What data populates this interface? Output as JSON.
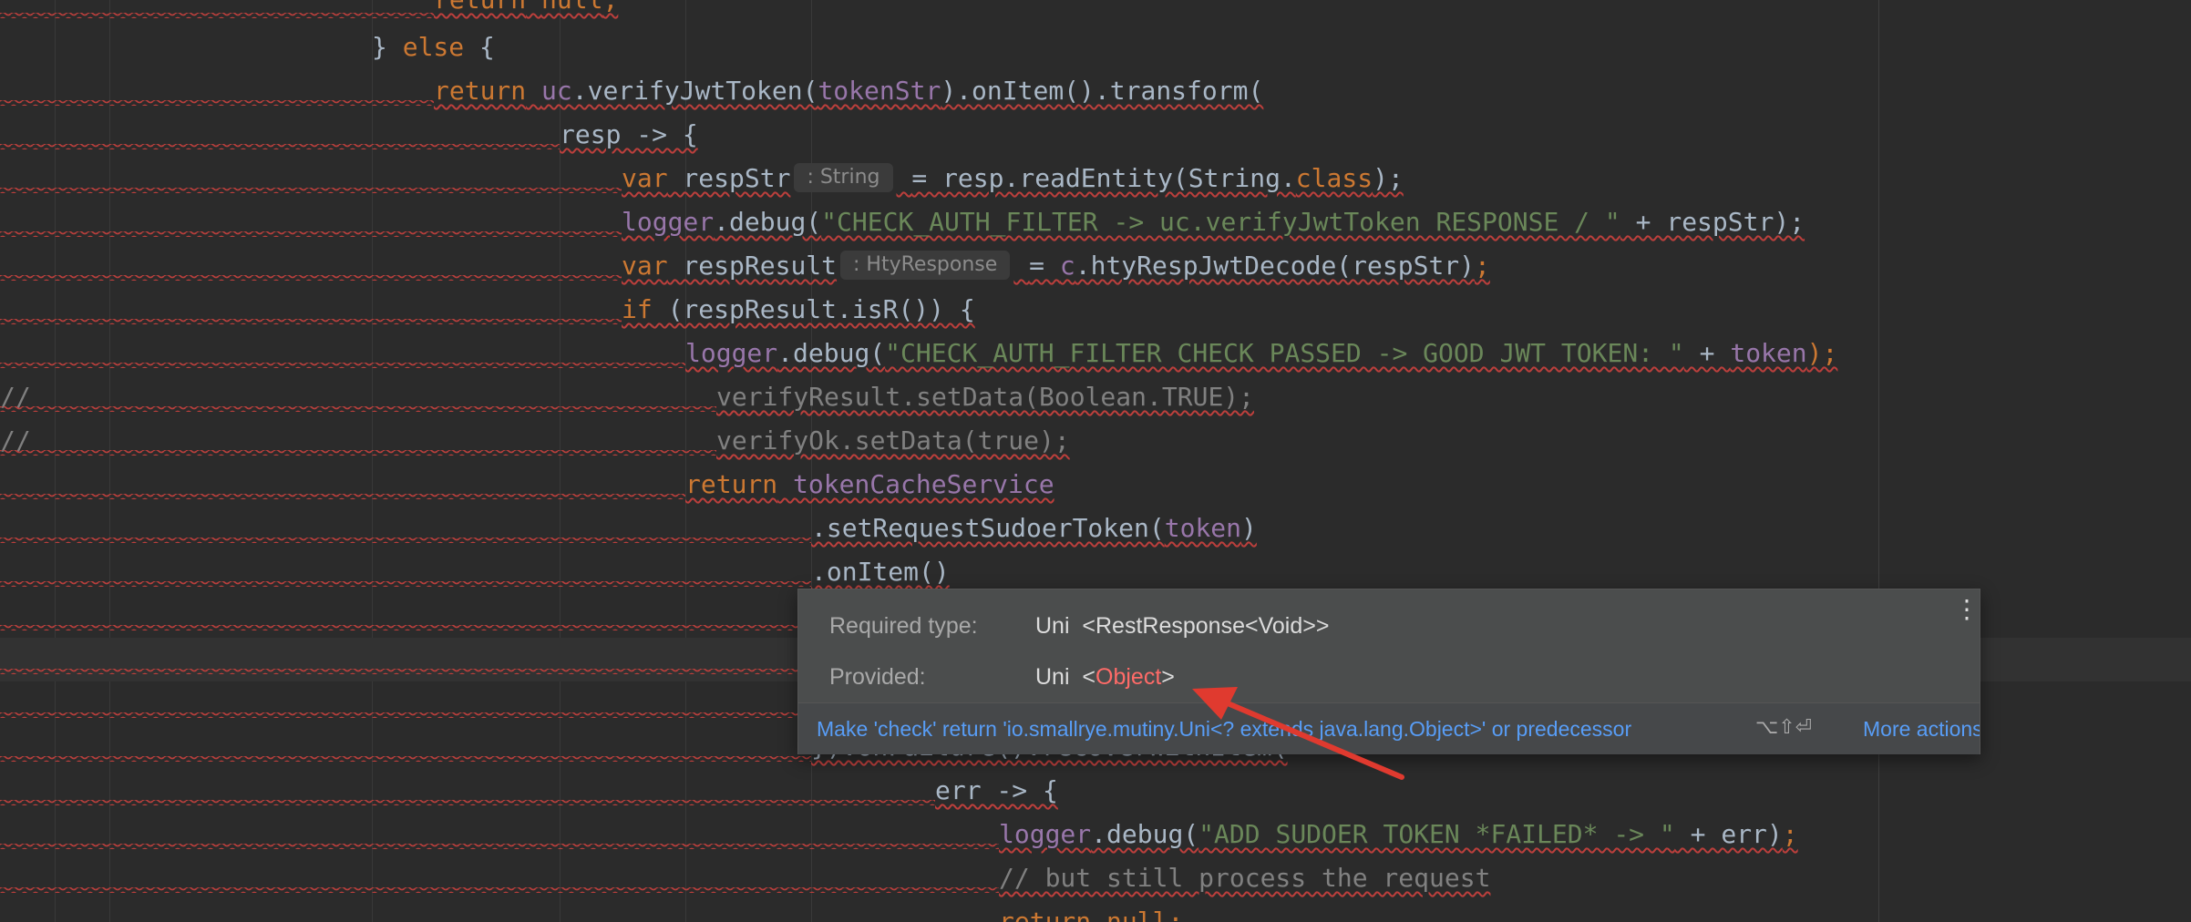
{
  "code_lines": [
    {
      "num": "1",
      "top": 0,
      "indent": 476,
      "parts": [
        {
          "t": "return null;",
          "c": "kw"
        }
      ]
    },
    {
      "num": "2",
      "top": 0,
      "indent": 0,
      "parts": []
    },
    {
      "num": "3",
      "top": 0,
      "indent": 0,
      "parts": []
    }
  ],
  "lines": {
    "l0": {
      "return_kw": "return",
      "null_kw": "null",
      "semi": ";"
    },
    "l1": {
      "brace": "} ",
      "else_kw": "else",
      "brace2": " {"
    },
    "l2": {
      "return_kw": "return",
      "uc": "uc",
      "call": ".verifyJwtToken(",
      "arg": "tokenStr",
      "rest": ").onItem().transform("
    },
    "l3": {
      "text": "resp -> {"
    },
    "l4": {
      "var_kw": "var",
      "name": " respStr",
      "hint": ": String",
      "rest": "= resp.readEntity(String.",
      "class_kw": "class",
      "end": ");"
    },
    "l5": {
      "logger": "logger",
      "call": ".debug(",
      "str": "\"CHECK_AUTH_FILTER -> uc.verifyJwtToken RESPONSE / \"",
      "rest": " + respStr);"
    },
    "l6": {
      "var_kw": "var",
      "name": " respResult",
      "hint": ": HtyResponse",
      "eq": "= ",
      "c": "c",
      "rest": ".htyRespJwtDecode(respStr)",
      "semi": ";"
    },
    "l7": {
      "if_kw": "if",
      "rest": " (respResult.isR()) {"
    },
    "l8": {
      "logger": "logger",
      "call": ".debug(",
      "str": "\"CHECK_AUTH_FILTER CHECK PASSED -> GOOD JWT TOKEN: \"",
      "plus": " + ",
      "token": "token",
      "end": ");"
    },
    "l9": {
      "slashes": "//",
      "text": "verifyResult.setData(Boolean.TRUE);"
    },
    "l10": {
      "slashes": "//",
      "text": "verifyOk.setData(true);"
    },
    "l11": {
      "return_kw": "return",
      "svc": " tokenCacheService"
    },
    "l12": {
      "call": ".setRequestSudoerToken(",
      "token": "token",
      "end": ")"
    },
    "l13": {
      "text": ".onItem()"
    },
    "l14": {
      "text": "}).onFailure().recoverWithItem("
    },
    "l15": {
      "text": "err -> {"
    },
    "l16": {
      "logger": "logger",
      "call": ".debug(",
      "str": "\"ADD SUDOER TOKEN *FAILED* -> \"",
      "rest": " + err)",
      "semi": ";"
    },
    "l17": {
      "text": "// but still process the request"
    },
    "l18": {
      "return_kw": "return",
      "null_kw": " null",
      "semi": ";"
    }
  },
  "popup": {
    "required_label": "Required type:",
    "required_value": "Uni  <RestResponse<Void>>",
    "provided_label": "Provided:",
    "provided_prefix": "Uni  <",
    "provided_type": "Object",
    "provided_suffix": ">",
    "menu_icon": "vertical-dots-icon",
    "fix_action": "Make 'check' return 'io.smallrye.mutiny.Uni<? extends java.lang.Object>' or predecessor",
    "fix_shortcut": "⌥⇧⏎",
    "more_actions": "More actions"
  },
  "colors": {
    "background": "#2b2b2b",
    "keyword": "#cc7832",
    "field": "#9876aa",
    "string": "#6a8759",
    "comment": "#808080",
    "error_underline": "#bc3f3c",
    "popup_bg": "#4b4d4d",
    "link": "#589df6",
    "error_type": "#ff6b68",
    "annotation_arrow": "#e03a2f"
  }
}
